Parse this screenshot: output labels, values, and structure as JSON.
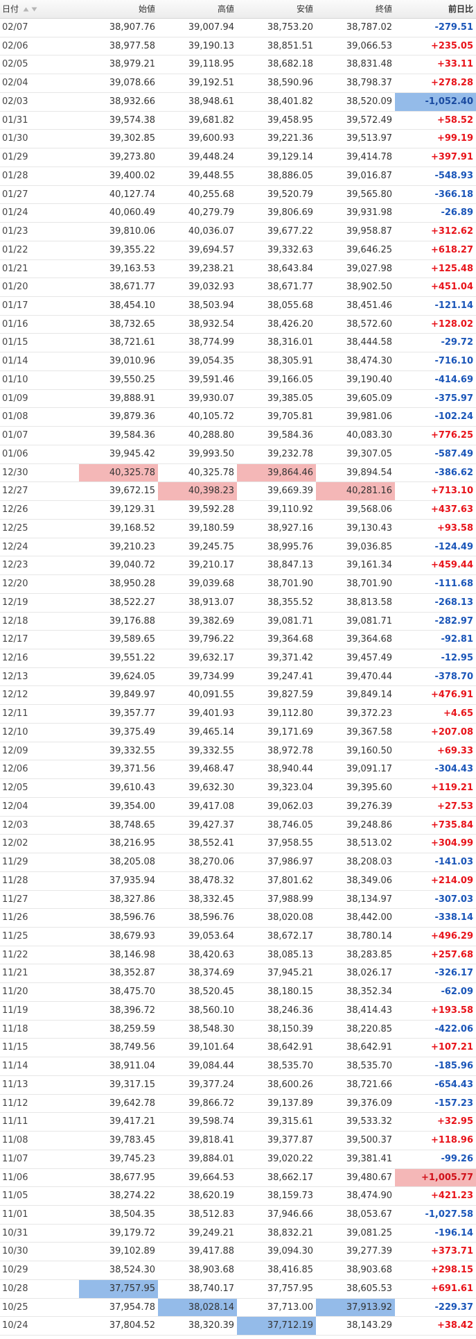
{
  "header": {
    "date": "日付",
    "open": "始値",
    "high": "高値",
    "low": "安値",
    "close": "終値",
    "change": "前日比"
  },
  "colors": {
    "positive": "#e8131a",
    "negative": "#1a55b8",
    "highlight_high": "#f4b7b7",
    "highlight_low": "#94bbe9"
  },
  "rows": [
    {
      "date": "02/07",
      "open": "38,907.76",
      "high": "39,007.94",
      "low": "38,753.20",
      "close": "38,787.02",
      "change": "-279.51"
    },
    {
      "date": "02/06",
      "open": "38,977.58",
      "high": "39,190.13",
      "low": "38,851.51",
      "close": "39,066.53",
      "change": "+235.05"
    },
    {
      "date": "02/05",
      "open": "38,979.21",
      "high": "39,118.95",
      "low": "38,682.18",
      "close": "38,831.48",
      "change": "+33.11"
    },
    {
      "date": "02/04",
      "open": "39,078.66",
      "high": "39,192.51",
      "low": "38,590.96",
      "close": "38,798.37",
      "change": "+278.28"
    },
    {
      "date": "02/03",
      "open": "38,932.66",
      "high": "38,948.61",
      "low": "38,401.82",
      "close": "38,520.09",
      "change": "-1,052.40",
      "hl": {
        "change": "lo"
      }
    },
    {
      "date": "01/31",
      "open": "39,574.38",
      "high": "39,681.82",
      "low": "39,458.95",
      "close": "39,572.49",
      "change": "+58.52"
    },
    {
      "date": "01/30",
      "open": "39,302.85",
      "high": "39,600.93",
      "low": "39,221.36",
      "close": "39,513.97",
      "change": "+99.19"
    },
    {
      "date": "01/29",
      "open": "39,273.80",
      "high": "39,448.24",
      "low": "39,129.14",
      "close": "39,414.78",
      "change": "+397.91"
    },
    {
      "date": "01/28",
      "open": "39,400.02",
      "high": "39,448.55",
      "low": "38,886.05",
      "close": "39,016.87",
      "change": "-548.93"
    },
    {
      "date": "01/27",
      "open": "40,127.74",
      "high": "40,255.68",
      "low": "39,520.79",
      "close": "39,565.80",
      "change": "-366.18"
    },
    {
      "date": "01/24",
      "open": "40,060.49",
      "high": "40,279.79",
      "low": "39,806.69",
      "close": "39,931.98",
      "change": "-26.89"
    },
    {
      "date": "01/23",
      "open": "39,810.06",
      "high": "40,036.07",
      "low": "39,677.22",
      "close": "39,958.87",
      "change": "+312.62"
    },
    {
      "date": "01/22",
      "open": "39,355.22",
      "high": "39,694.57",
      "low": "39,332.63",
      "close": "39,646.25",
      "change": "+618.27"
    },
    {
      "date": "01/21",
      "open": "39,163.53",
      "high": "39,238.21",
      "low": "38,643.84",
      "close": "39,027.98",
      "change": "+125.48"
    },
    {
      "date": "01/20",
      "open": "38,671.77",
      "high": "39,032.93",
      "low": "38,671.77",
      "close": "38,902.50",
      "change": "+451.04"
    },
    {
      "date": "01/17",
      "open": "38,454.10",
      "high": "38,503.94",
      "low": "38,055.68",
      "close": "38,451.46",
      "change": "-121.14"
    },
    {
      "date": "01/16",
      "open": "38,732.65",
      "high": "38,932.54",
      "low": "38,426.20",
      "close": "38,572.60",
      "change": "+128.02"
    },
    {
      "date": "01/15",
      "open": "38,721.61",
      "high": "38,774.99",
      "low": "38,316.01",
      "close": "38,444.58",
      "change": "-29.72"
    },
    {
      "date": "01/14",
      "open": "39,010.96",
      "high": "39,054.35",
      "low": "38,305.91",
      "close": "38,474.30",
      "change": "-716.10"
    },
    {
      "date": "01/10",
      "open": "39,550.25",
      "high": "39,591.46",
      "low": "39,166.05",
      "close": "39,190.40",
      "change": "-414.69"
    },
    {
      "date": "01/09",
      "open": "39,888.91",
      "high": "39,930.07",
      "low": "39,385.05",
      "close": "39,605.09",
      "change": "-375.97"
    },
    {
      "date": "01/08",
      "open": "39,879.36",
      "high": "40,105.72",
      "low": "39,705.81",
      "close": "39,981.06",
      "change": "-102.24"
    },
    {
      "date": "01/07",
      "open": "39,584.36",
      "high": "40,288.80",
      "low": "39,584.36",
      "close": "40,083.30",
      "change": "+776.25"
    },
    {
      "date": "01/06",
      "open": "39,945.42",
      "high": "39,993.50",
      "low": "39,232.78",
      "close": "39,307.05",
      "change": "-587.49"
    },
    {
      "date": "12/30",
      "open": "40,325.78",
      "high": "40,325.78",
      "low": "39,864.46",
      "close": "39,894.54",
      "change": "-386.62",
      "hl": {
        "open": "hi",
        "low": "hi"
      }
    },
    {
      "date": "12/27",
      "open": "39,672.15",
      "high": "40,398.23",
      "low": "39,669.39",
      "close": "40,281.16",
      "change": "+713.10",
      "hl": {
        "high": "hi",
        "close": "hi"
      }
    },
    {
      "date": "12/26",
      "open": "39,129.31",
      "high": "39,592.28",
      "low": "39,110.92",
      "close": "39,568.06",
      "change": "+437.63"
    },
    {
      "date": "12/25",
      "open": "39,168.52",
      "high": "39,180.59",
      "low": "38,927.16",
      "close": "39,130.43",
      "change": "+93.58"
    },
    {
      "date": "12/24",
      "open": "39,210.23",
      "high": "39,245.75",
      "low": "38,995.76",
      "close": "39,036.85",
      "change": "-124.49"
    },
    {
      "date": "12/23",
      "open": "39,040.72",
      "high": "39,210.17",
      "low": "38,847.13",
      "close": "39,161.34",
      "change": "+459.44"
    },
    {
      "date": "12/20",
      "open": "38,950.28",
      "high": "39,039.68",
      "low": "38,701.90",
      "close": "38,701.90",
      "change": "-111.68"
    },
    {
      "date": "12/19",
      "open": "38,522.27",
      "high": "38,913.07",
      "low": "38,355.52",
      "close": "38,813.58",
      "change": "-268.13"
    },
    {
      "date": "12/18",
      "open": "39,176.88",
      "high": "39,382.69",
      "low": "39,081.71",
      "close": "39,081.71",
      "change": "-282.97"
    },
    {
      "date": "12/17",
      "open": "39,589.65",
      "high": "39,796.22",
      "low": "39,364.68",
      "close": "39,364.68",
      "change": "-92.81"
    },
    {
      "date": "12/16",
      "open": "39,551.22",
      "high": "39,632.17",
      "low": "39,371.42",
      "close": "39,457.49",
      "change": "-12.95"
    },
    {
      "date": "12/13",
      "open": "39,624.05",
      "high": "39,734.99",
      "low": "39,247.41",
      "close": "39,470.44",
      "change": "-378.70"
    },
    {
      "date": "12/12",
      "open": "39,849.97",
      "high": "40,091.55",
      "low": "39,827.59",
      "close": "39,849.14",
      "change": "+476.91"
    },
    {
      "date": "12/11",
      "open": "39,357.77",
      "high": "39,401.93",
      "low": "39,112.80",
      "close": "39,372.23",
      "change": "+4.65"
    },
    {
      "date": "12/10",
      "open": "39,375.49",
      "high": "39,465.14",
      "low": "39,171.69",
      "close": "39,367.58",
      "change": "+207.08"
    },
    {
      "date": "12/09",
      "open": "39,332.55",
      "high": "39,332.55",
      "low": "38,972.78",
      "close": "39,160.50",
      "change": "+69.33"
    },
    {
      "date": "12/06",
      "open": "39,371.56",
      "high": "39,468.47",
      "low": "38,940.44",
      "close": "39,091.17",
      "change": "-304.43"
    },
    {
      "date": "12/05",
      "open": "39,610.43",
      "high": "39,632.30",
      "low": "39,323.04",
      "close": "39,395.60",
      "change": "+119.21"
    },
    {
      "date": "12/04",
      "open": "39,354.00",
      "high": "39,417.08",
      "low": "39,062.03",
      "close": "39,276.39",
      "change": "+27.53"
    },
    {
      "date": "12/03",
      "open": "38,748.65",
      "high": "39,427.37",
      "low": "38,746.05",
      "close": "39,248.86",
      "change": "+735.84"
    },
    {
      "date": "12/02",
      "open": "38,216.95",
      "high": "38,552.41",
      "low": "37,958.55",
      "close": "38,513.02",
      "change": "+304.99"
    },
    {
      "date": "11/29",
      "open": "38,205.08",
      "high": "38,270.06",
      "low": "37,986.97",
      "close": "38,208.03",
      "change": "-141.03"
    },
    {
      "date": "11/28",
      "open": "37,935.94",
      "high": "38,478.32",
      "low": "37,801.62",
      "close": "38,349.06",
      "change": "+214.09"
    },
    {
      "date": "11/27",
      "open": "38,327.86",
      "high": "38,332.45",
      "low": "37,988.99",
      "close": "38,134.97",
      "change": "-307.03"
    },
    {
      "date": "11/26",
      "open": "38,596.76",
      "high": "38,596.76",
      "low": "38,020.08",
      "close": "38,442.00",
      "change": "-338.14"
    },
    {
      "date": "11/25",
      "open": "38,679.93",
      "high": "39,053.64",
      "low": "38,672.17",
      "close": "38,780.14",
      "change": "+496.29"
    },
    {
      "date": "11/22",
      "open": "38,146.98",
      "high": "38,420.63",
      "low": "38,085.13",
      "close": "38,283.85",
      "change": "+257.68"
    },
    {
      "date": "11/21",
      "open": "38,352.87",
      "high": "38,374.69",
      "low": "37,945.21",
      "close": "38,026.17",
      "change": "-326.17"
    },
    {
      "date": "11/20",
      "open": "38,475.70",
      "high": "38,520.45",
      "low": "38,180.15",
      "close": "38,352.34",
      "change": "-62.09"
    },
    {
      "date": "11/19",
      "open": "38,396.72",
      "high": "38,560.10",
      "low": "38,246.36",
      "close": "38,414.43",
      "change": "+193.58"
    },
    {
      "date": "11/18",
      "open": "38,259.59",
      "high": "38,548.30",
      "low": "38,150.39",
      "close": "38,220.85",
      "change": "-422.06"
    },
    {
      "date": "11/15",
      "open": "38,749.56",
      "high": "39,101.64",
      "low": "38,642.91",
      "close": "38,642.91",
      "change": "+107.21"
    },
    {
      "date": "11/14",
      "open": "38,911.04",
      "high": "39,084.44",
      "low": "38,535.70",
      "close": "38,535.70",
      "change": "-185.96"
    },
    {
      "date": "11/13",
      "open": "39,317.15",
      "high": "39,377.24",
      "low": "38,600.26",
      "close": "38,721.66",
      "change": "-654.43"
    },
    {
      "date": "11/12",
      "open": "39,642.78",
      "high": "39,866.72",
      "low": "39,137.89",
      "close": "39,376.09",
      "change": "-157.23"
    },
    {
      "date": "11/11",
      "open": "39,417.21",
      "high": "39,598.74",
      "low": "39,315.61",
      "close": "39,533.32",
      "change": "+32.95"
    },
    {
      "date": "11/08",
      "open": "39,783.45",
      "high": "39,818.41",
      "low": "39,377.87",
      "close": "39,500.37",
      "change": "+118.96"
    },
    {
      "date": "11/07",
      "open": "39,745.23",
      "high": "39,884.01",
      "low": "39,020.22",
      "close": "39,381.41",
      "change": "-99.26"
    },
    {
      "date": "11/06",
      "open": "38,677.95",
      "high": "39,664.53",
      "low": "38,662.17",
      "close": "39,480.67",
      "change": "+1,005.77",
      "hl": {
        "change": "hi"
      }
    },
    {
      "date": "11/05",
      "open": "38,274.22",
      "high": "38,620.19",
      "low": "38,159.73",
      "close": "38,474.90",
      "change": "+421.23"
    },
    {
      "date": "11/01",
      "open": "38,504.35",
      "high": "38,512.83",
      "low": "37,946.66",
      "close": "38,053.67",
      "change": "-1,027.58"
    },
    {
      "date": "10/31",
      "open": "39,179.72",
      "high": "39,249.21",
      "low": "38,832.21",
      "close": "39,081.25",
      "change": "-196.14"
    },
    {
      "date": "10/30",
      "open": "39,102.89",
      "high": "39,417.88",
      "low": "39,094.30",
      "close": "39,277.39",
      "change": "+373.71"
    },
    {
      "date": "10/29",
      "open": "38,524.30",
      "high": "38,903.68",
      "low": "38,416.85",
      "close": "38,903.68",
      "change": "+298.15"
    },
    {
      "date": "10/28",
      "open": "37,757.95",
      "high": "38,740.17",
      "low": "37,757.95",
      "close": "38,605.53",
      "change": "+691.61",
      "hl": {
        "open": "lo"
      }
    },
    {
      "date": "10/25",
      "open": "37,954.78",
      "high": "38,028.14",
      "low": "37,713.00",
      "close": "37,913.92",
      "change": "-229.37",
      "hl": {
        "high": "lo",
        "close": "lo"
      }
    },
    {
      "date": "10/24",
      "open": "37,804.52",
      "high": "38,320.39",
      "low": "37,712.19",
      "close": "38,143.29",
      "change": "+38.42",
      "hl": {
        "low": "lo"
      }
    }
  ]
}
